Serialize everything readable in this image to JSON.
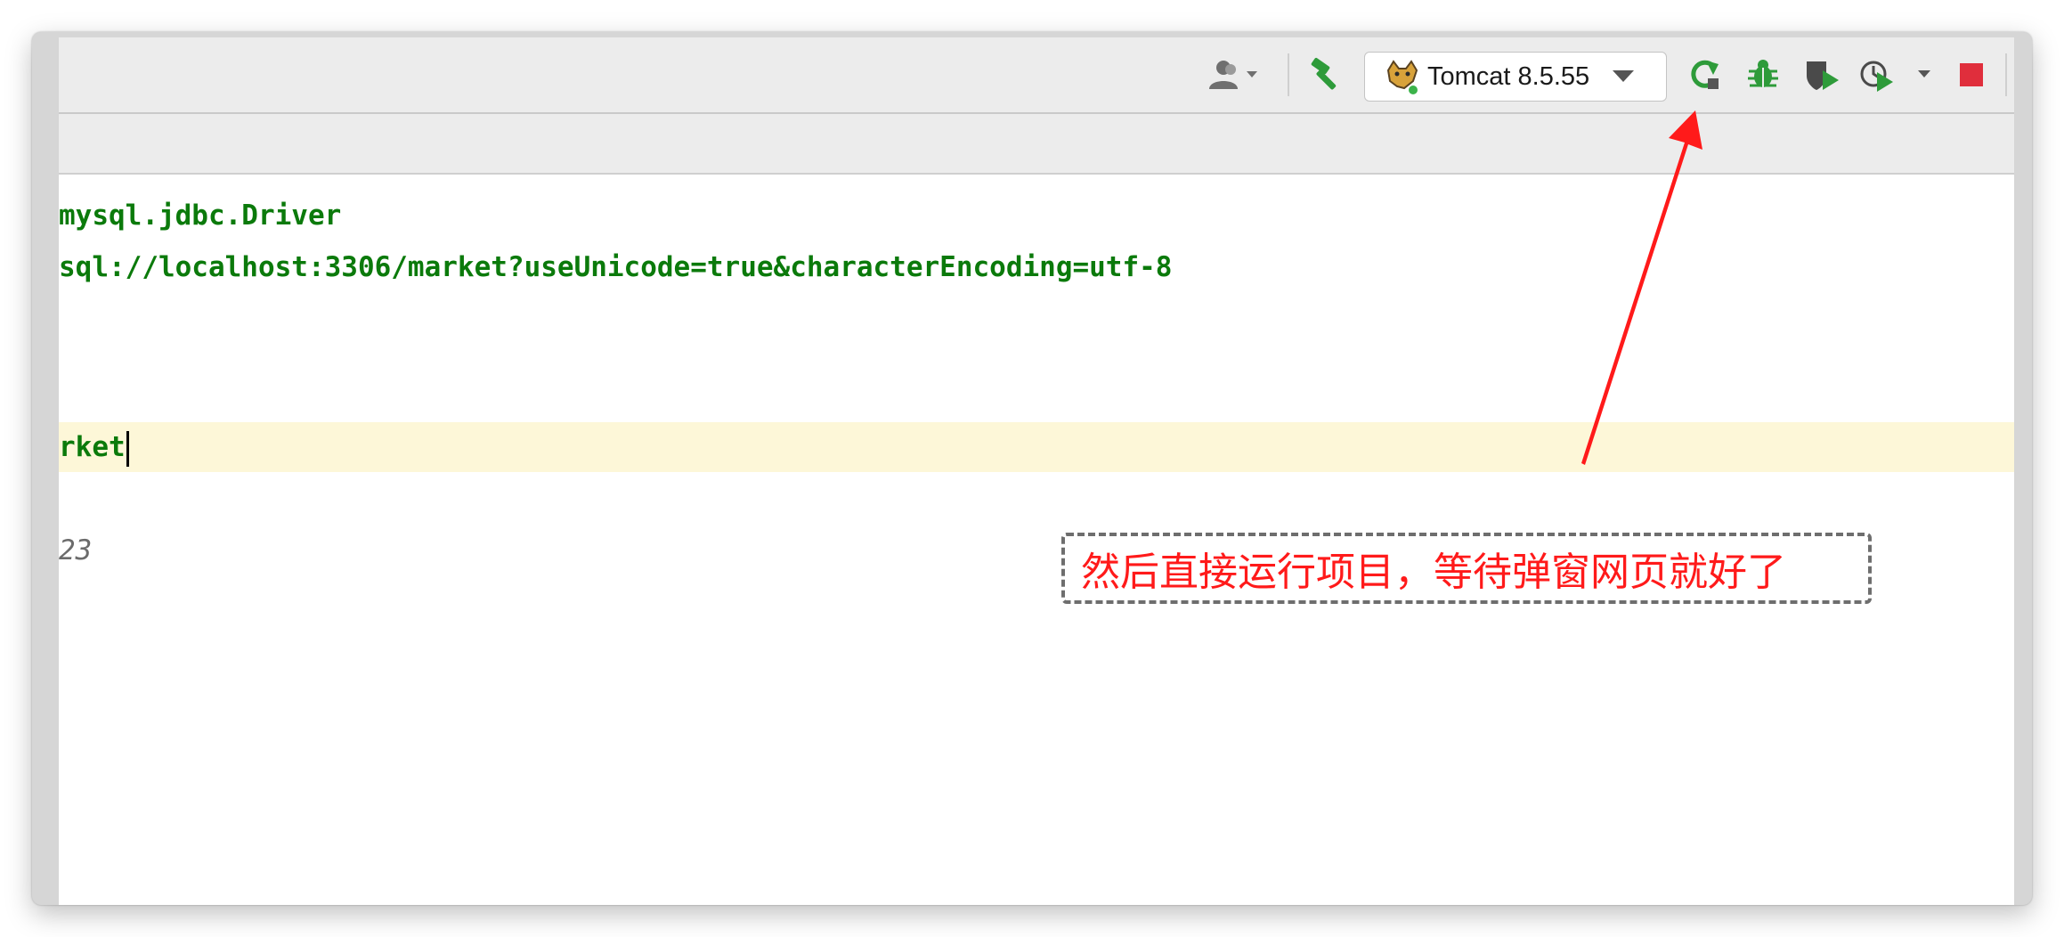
{
  "toolbar": {
    "run_config_label": "Tomcat 8.5.55",
    "icons": {
      "user": "user-icon",
      "build": "hammer-icon",
      "rerun": "rerun-icon",
      "debug": "bug-icon",
      "coverage": "coverage-icon",
      "profile": "profile-icon",
      "stop": "stop-icon"
    },
    "colors": {
      "green": "#2e9b3a",
      "stop": "#e02e3c"
    }
  },
  "editor": {
    "lines": [
      {
        "text": "mysql.jdbc.Driver"
      },
      {
        "text": "sql://localhost:3306/market?useUnicode=true&characterEncoding=utf-8"
      },
      {
        "text": ""
      },
      {
        "text": "rket"
      },
      {
        "text": "23"
      }
    ],
    "code_color": "#0b7a0b"
  },
  "annotation": {
    "text": "然后直接运行项目，等待弹窗网页就好了",
    "color": "#ff1a1a"
  }
}
